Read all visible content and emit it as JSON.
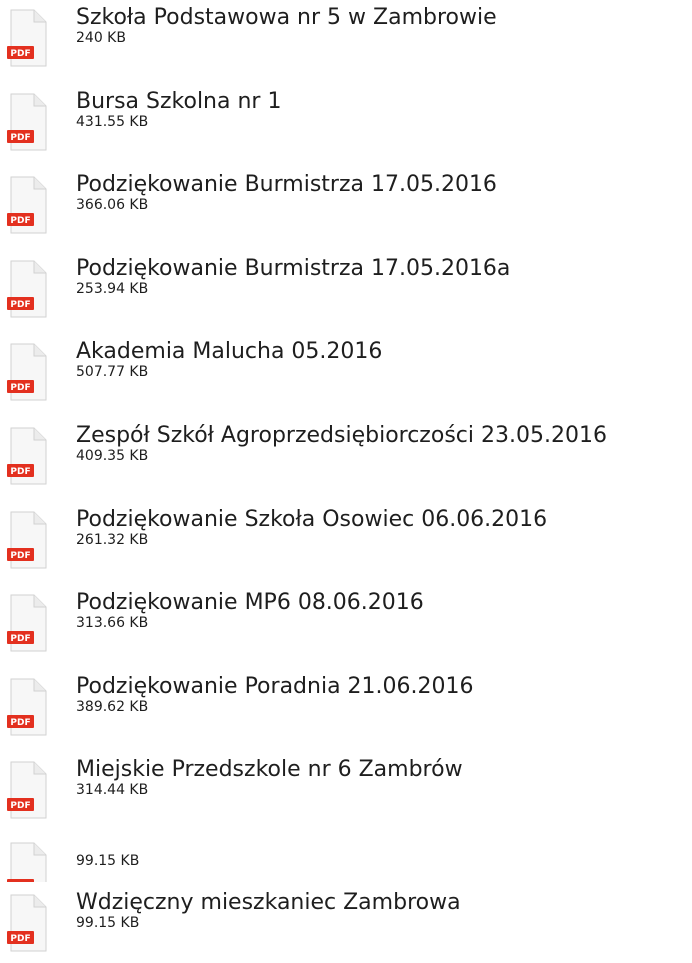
{
  "icon": "pdf-file-icon",
  "icon_label": "PDF",
  "colors": {
    "pdf_red": "#e3301f",
    "page_fill": "#f7f7f7",
    "page_border": "#d2d2d2",
    "text": "#1e1e1e"
  },
  "files": [
    {
      "title": "Szkoła Podstawowa nr 5 w Zambrowie",
      "size": "240 KB"
    },
    {
      "title": "Bursa Szkolna nr 1",
      "size": "431.55 KB"
    },
    {
      "title": "Podziękowanie Burmistrza 17.05.2016",
      "size": "366.06 KB"
    },
    {
      "title": "Podziękowanie Burmistrza 17.05.2016a",
      "size": "253.94 KB"
    },
    {
      "title": "Akademia Malucha 05.2016",
      "size": "507.77 KB"
    },
    {
      "title": "Zespół Szkół Agroprzedsiębiorczości 23.05.2016",
      "size": "409.35 KB"
    },
    {
      "title": "Podziękowanie Szkoła Osowiec 06.06.2016",
      "size": "261.32 KB"
    },
    {
      "title": "Podziękowanie MP6 08.06.2016",
      "size": "313.66 KB"
    },
    {
      "title": "Podziękowanie Poradnia 21.06.2016",
      "size": "389.62 KB"
    },
    {
      "title": "Miejskie Przedszkole nr 6 Zambrów",
      "size": "314.44 KB"
    },
    {
      "title": "",
      "size": "99.15 KB"
    },
    {
      "title": "Wdzięczny mieszkaniec Zambrowa",
      "size": "99.15 KB"
    }
  ]
}
